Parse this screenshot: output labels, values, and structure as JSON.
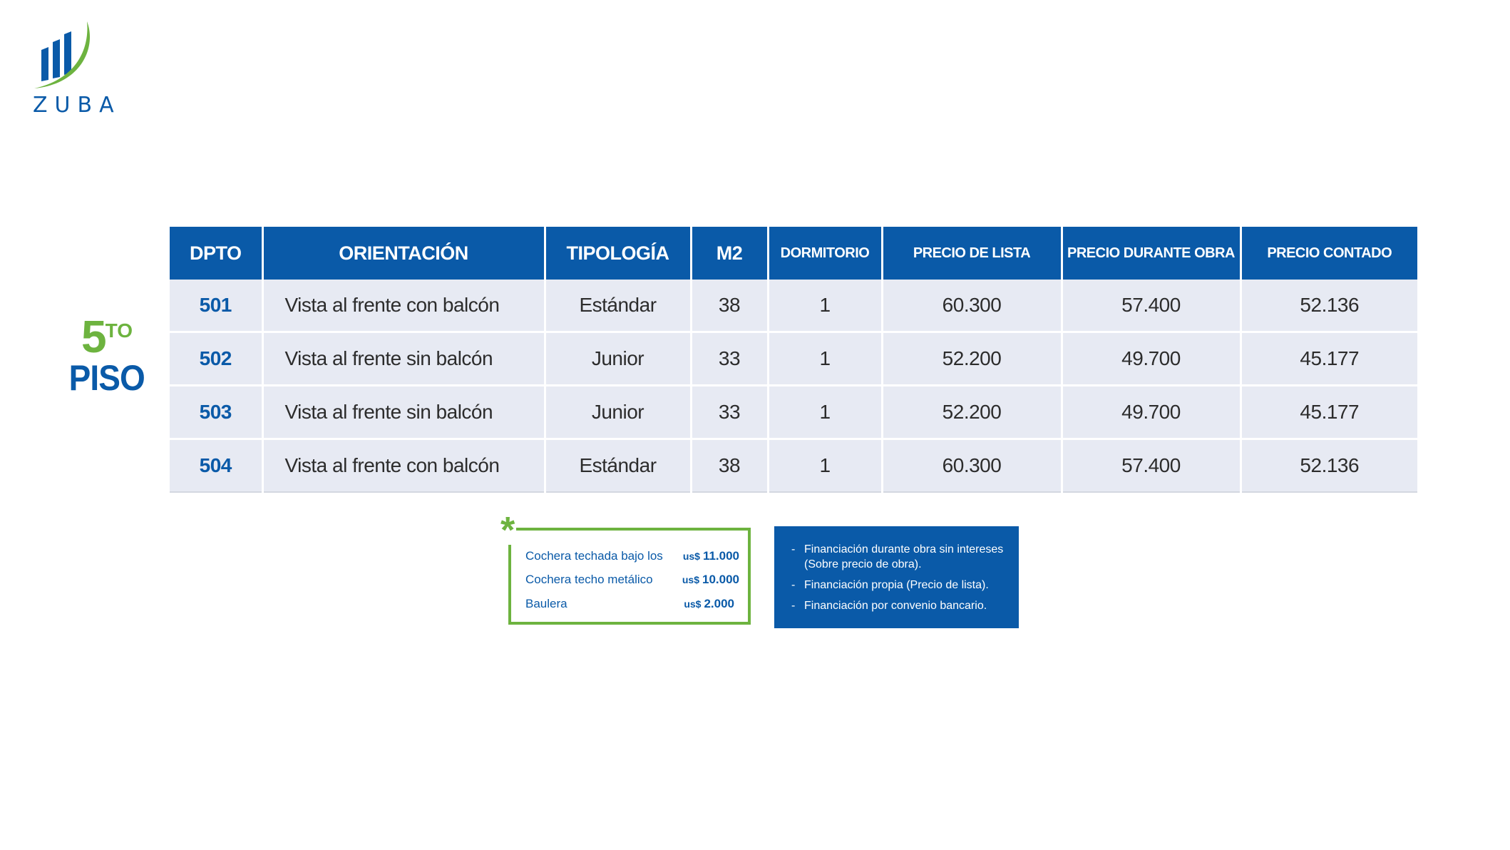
{
  "brand": {
    "name": "ZUBA",
    "colors": {
      "primary": "#0a5aa8",
      "accent": "#6db33f"
    }
  },
  "floor": {
    "number": "5",
    "suffix": "TO",
    "label": "PISO"
  },
  "table": {
    "headers": [
      "DPTO",
      "ORIENTACIÓN",
      "TIPOLOGÍA",
      "M2",
      "DORMITORIO",
      "PRECIO DE LISTA",
      "PRECIO DURANTE OBRA",
      "PRECIO CONTADO"
    ],
    "rows": [
      {
        "dpto": "501",
        "orientacion": "Vista al frente con balcón",
        "tipologia": "Estándar",
        "m2": "38",
        "dormitorio": "1",
        "precio_lista": "60.300",
        "precio_obra": "57.400",
        "precio_contado": "52.136"
      },
      {
        "dpto": "502",
        "orientacion": "Vista al frente sin balcón",
        "tipologia": "Junior",
        "m2": "33",
        "dormitorio": "1",
        "precio_lista": "52.200",
        "precio_obra": "49.700",
        "precio_contado": "45.177"
      },
      {
        "dpto": "503",
        "orientacion": "Vista al frente sin balcón",
        "tipologia": "Junior",
        "m2": "33",
        "dormitorio": "1",
        "precio_lista": "52.200",
        "precio_obra": "49.700",
        "precio_contado": "45.177"
      },
      {
        "dpto": "504",
        "orientacion": "Vista al frente con balcón",
        "tipologia": "Estándar",
        "m2": "38",
        "dormitorio": "1",
        "precio_lista": "60.300",
        "precio_obra": "57.400",
        "precio_contado": "52.136"
      }
    ]
  },
  "extras": {
    "asterisk": "*",
    "items": [
      {
        "label": "Cochera techada bajo los",
        "currency": "us$",
        "price": "11.000"
      },
      {
        "label": "Cochera techo metálico",
        "currency": "us$",
        "price": "10.000"
      },
      {
        "label": "Baulera",
        "currency": "us$",
        "price": "2.000"
      }
    ]
  },
  "financing": {
    "bullet": "-",
    "items": [
      {
        "line1": "Financiación durante obra sin intereses",
        "line2": "(Sobre precio de obra)."
      },
      {
        "line1": "Financiación propia (Precio de lista).",
        "line2": ""
      },
      {
        "line1": "Financiación por convenio bancario.",
        "line2": ""
      }
    ]
  }
}
